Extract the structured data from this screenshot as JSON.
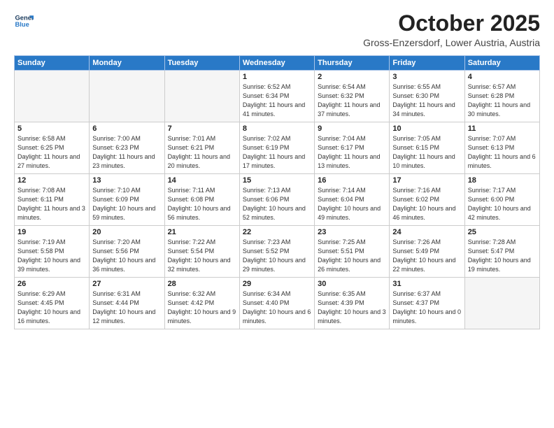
{
  "logo": {
    "line1": "General",
    "line2": "Blue"
  },
  "title": "October 2025",
  "location": "Gross-Enzersdorf, Lower Austria, Austria",
  "days_of_week": [
    "Sunday",
    "Monday",
    "Tuesday",
    "Wednesday",
    "Thursday",
    "Friday",
    "Saturday"
  ],
  "weeks": [
    [
      {
        "day": "",
        "info": ""
      },
      {
        "day": "",
        "info": ""
      },
      {
        "day": "",
        "info": ""
      },
      {
        "day": "1",
        "info": "Sunrise: 6:52 AM\nSunset: 6:34 PM\nDaylight: 11 hours\nand 41 minutes."
      },
      {
        "day": "2",
        "info": "Sunrise: 6:54 AM\nSunset: 6:32 PM\nDaylight: 11 hours\nand 37 minutes."
      },
      {
        "day": "3",
        "info": "Sunrise: 6:55 AM\nSunset: 6:30 PM\nDaylight: 11 hours\nand 34 minutes."
      },
      {
        "day": "4",
        "info": "Sunrise: 6:57 AM\nSunset: 6:28 PM\nDaylight: 11 hours\nand 30 minutes."
      }
    ],
    [
      {
        "day": "5",
        "info": "Sunrise: 6:58 AM\nSunset: 6:25 PM\nDaylight: 11 hours\nand 27 minutes."
      },
      {
        "day": "6",
        "info": "Sunrise: 7:00 AM\nSunset: 6:23 PM\nDaylight: 11 hours\nand 23 minutes."
      },
      {
        "day": "7",
        "info": "Sunrise: 7:01 AM\nSunset: 6:21 PM\nDaylight: 11 hours\nand 20 minutes."
      },
      {
        "day": "8",
        "info": "Sunrise: 7:02 AM\nSunset: 6:19 PM\nDaylight: 11 hours\nand 17 minutes."
      },
      {
        "day": "9",
        "info": "Sunrise: 7:04 AM\nSunset: 6:17 PM\nDaylight: 11 hours\nand 13 minutes."
      },
      {
        "day": "10",
        "info": "Sunrise: 7:05 AM\nSunset: 6:15 PM\nDaylight: 11 hours\nand 10 minutes."
      },
      {
        "day": "11",
        "info": "Sunrise: 7:07 AM\nSunset: 6:13 PM\nDaylight: 11 hours\nand 6 minutes."
      }
    ],
    [
      {
        "day": "12",
        "info": "Sunrise: 7:08 AM\nSunset: 6:11 PM\nDaylight: 11 hours\nand 3 minutes."
      },
      {
        "day": "13",
        "info": "Sunrise: 7:10 AM\nSunset: 6:09 PM\nDaylight: 10 hours\nand 59 minutes."
      },
      {
        "day": "14",
        "info": "Sunrise: 7:11 AM\nSunset: 6:08 PM\nDaylight: 10 hours\nand 56 minutes."
      },
      {
        "day": "15",
        "info": "Sunrise: 7:13 AM\nSunset: 6:06 PM\nDaylight: 10 hours\nand 52 minutes."
      },
      {
        "day": "16",
        "info": "Sunrise: 7:14 AM\nSunset: 6:04 PM\nDaylight: 10 hours\nand 49 minutes."
      },
      {
        "day": "17",
        "info": "Sunrise: 7:16 AM\nSunset: 6:02 PM\nDaylight: 10 hours\nand 46 minutes."
      },
      {
        "day": "18",
        "info": "Sunrise: 7:17 AM\nSunset: 6:00 PM\nDaylight: 10 hours\nand 42 minutes."
      }
    ],
    [
      {
        "day": "19",
        "info": "Sunrise: 7:19 AM\nSunset: 5:58 PM\nDaylight: 10 hours\nand 39 minutes."
      },
      {
        "day": "20",
        "info": "Sunrise: 7:20 AM\nSunset: 5:56 PM\nDaylight: 10 hours\nand 36 minutes."
      },
      {
        "day": "21",
        "info": "Sunrise: 7:22 AM\nSunset: 5:54 PM\nDaylight: 10 hours\nand 32 minutes."
      },
      {
        "day": "22",
        "info": "Sunrise: 7:23 AM\nSunset: 5:52 PM\nDaylight: 10 hours\nand 29 minutes."
      },
      {
        "day": "23",
        "info": "Sunrise: 7:25 AM\nSunset: 5:51 PM\nDaylight: 10 hours\nand 26 minutes."
      },
      {
        "day": "24",
        "info": "Sunrise: 7:26 AM\nSunset: 5:49 PM\nDaylight: 10 hours\nand 22 minutes."
      },
      {
        "day": "25",
        "info": "Sunrise: 7:28 AM\nSunset: 5:47 PM\nDaylight: 10 hours\nand 19 minutes."
      }
    ],
    [
      {
        "day": "26",
        "info": "Sunrise: 6:29 AM\nSunset: 4:45 PM\nDaylight: 10 hours\nand 16 minutes."
      },
      {
        "day": "27",
        "info": "Sunrise: 6:31 AM\nSunset: 4:44 PM\nDaylight: 10 hours\nand 12 minutes."
      },
      {
        "day": "28",
        "info": "Sunrise: 6:32 AM\nSunset: 4:42 PM\nDaylight: 10 hours\nand 9 minutes."
      },
      {
        "day": "29",
        "info": "Sunrise: 6:34 AM\nSunset: 4:40 PM\nDaylight: 10 hours\nand 6 minutes."
      },
      {
        "day": "30",
        "info": "Sunrise: 6:35 AM\nSunset: 4:39 PM\nDaylight: 10 hours\nand 3 minutes."
      },
      {
        "day": "31",
        "info": "Sunrise: 6:37 AM\nSunset: 4:37 PM\nDaylight: 10 hours\nand 0 minutes."
      },
      {
        "day": "",
        "info": ""
      }
    ]
  ]
}
